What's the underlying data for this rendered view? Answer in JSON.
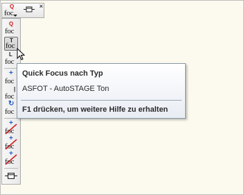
{
  "toolbar": {
    "buttons": [
      {
        "label": "foc",
        "glyph": "Q"
      },
      {
        "label": "foc",
        "glyph": "T"
      },
      {
        "label": "foc",
        "glyph": "L"
      },
      {
        "label": "foc",
        "glyph": "+"
      },
      {
        "label": "foc",
        "glyph": "|"
      },
      {
        "label": "foc",
        "glyph": "↻"
      },
      {
        "label": "foc",
        "glyph": "+"
      },
      {
        "label": "foc",
        "glyph": "+"
      },
      {
        "label": "foc",
        "glyph": "+"
      }
    ],
    "top_button": {
      "label": "foc",
      "glyph": "Q"
    }
  },
  "tooltip": {
    "title": "Quick Focus nach Typ",
    "body": "ASFOT - AutoSTAGE Ton",
    "help": "F1 drücken, um weitere Hilfe zu erhalten"
  },
  "colors": {
    "background": "#fcfaee",
    "tooltip_border": "#8a96a8",
    "red_mark": "#d21919",
    "blue_mark": "#1f58c4"
  }
}
